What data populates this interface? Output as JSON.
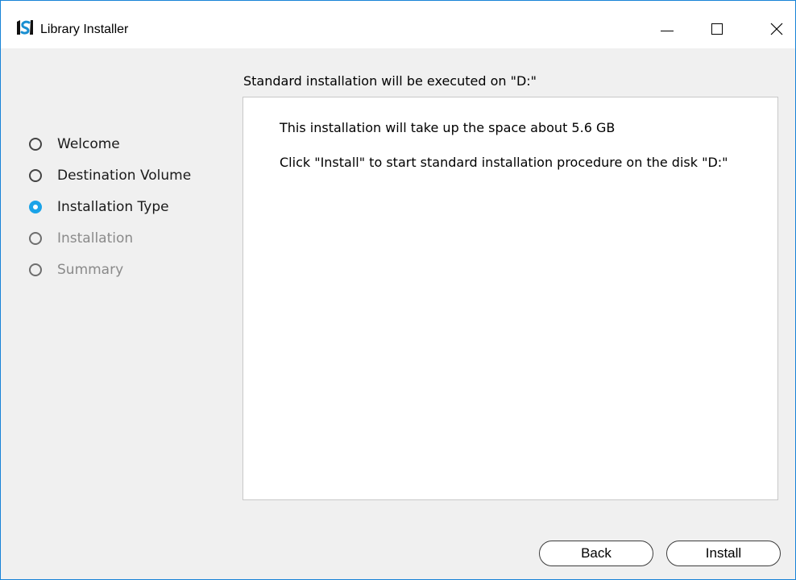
{
  "window": {
    "title": "Library Installer",
    "accent_color": "#1883d7",
    "icons": {
      "app": "library-installer-logo-icon",
      "minimize": "minimize-icon",
      "maximize": "maximize-icon",
      "close": "close-icon"
    }
  },
  "steps": [
    {
      "label": "Welcome",
      "state": "completed"
    },
    {
      "label": "Destination Volume",
      "state": "completed"
    },
    {
      "label": "Installation Type",
      "state": "current"
    },
    {
      "label": "Installation",
      "state": "pending"
    },
    {
      "label": "Summary",
      "state": "pending"
    }
  ],
  "main": {
    "heading": "Standard installation will be executed on \"D:\"",
    "line1": "This installation will take up the space about 5.6 GB",
    "line2": "Click \"Install\" to start standard installation procedure on the disk \"D:\""
  },
  "buttons": {
    "back": "Back",
    "install": "Install"
  },
  "colors": {
    "current_step": "#1aa3e8",
    "disabled_text": "#8a8a8a"
  }
}
